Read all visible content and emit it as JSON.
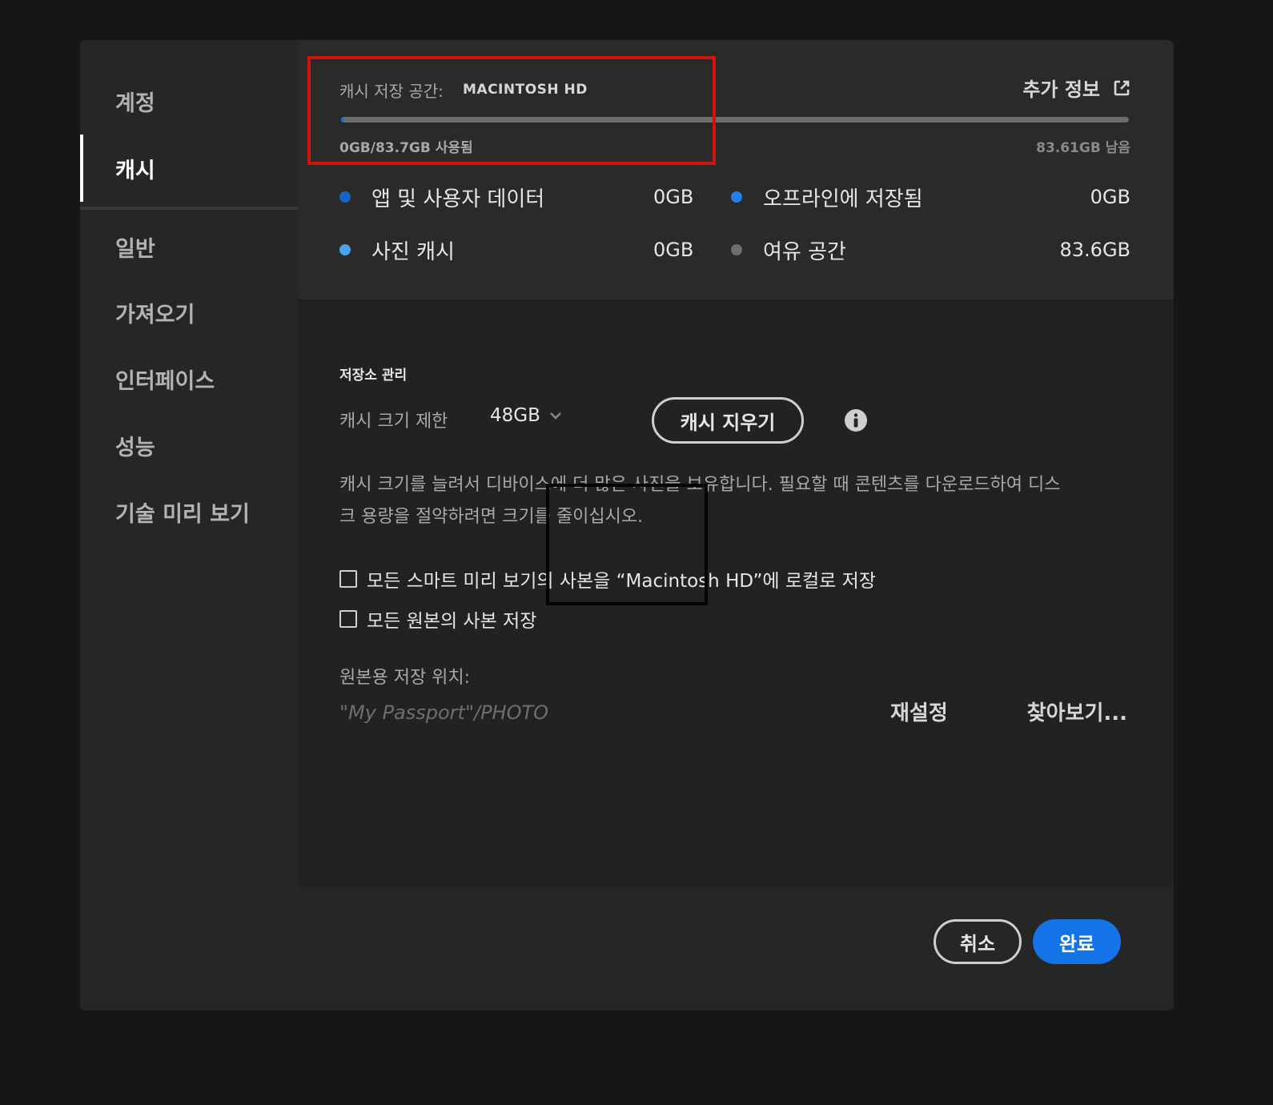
{
  "sidebar": {
    "items": [
      {
        "label": "계정",
        "active": false
      },
      {
        "label": "캐시",
        "active": true
      },
      {
        "label": "일반",
        "active": false
      },
      {
        "label": "가져오기",
        "active": false
      },
      {
        "label": "인터페이스",
        "active": false
      },
      {
        "label": "성능",
        "active": false
      },
      {
        "label": "기술 미리 보기",
        "active": false
      }
    ]
  },
  "storage": {
    "label": "캐시 저장 공간:",
    "drive_name": "MACINTOSH HD",
    "more_info": "추가 정보",
    "more_info_icon": "external-link-icon",
    "used_text": "0GB/83.7GB 사용됨",
    "remaining_text": "83.61GB 남음",
    "used_fraction": 0.001,
    "legend": [
      {
        "label": "앱 및 사용자 데이터",
        "value": "0GB",
        "color": "#1565c0"
      },
      {
        "label": "오프라인에 저장됨",
        "value": "0GB",
        "color": "#2680eb"
      },
      {
        "label": "사진 캐시",
        "value": "0GB",
        "color": "#4aa3f0"
      },
      {
        "label": "여유 공간",
        "value": "83.6GB",
        "color": "#6e6e6e"
      }
    ]
  },
  "management": {
    "title": "저장소 관리",
    "cache_limit_label": "캐시 크기 제한",
    "cache_limit_value": "48GB",
    "clear_cache": "캐시 지우기",
    "info_icon": "info-icon",
    "description": "캐시 크기를 늘려서 디바이스에 더 많은 사진을 보유합니다. 필요할 때 콘텐츠를 다운로드하여 디스크 용량을 절약하려면 크기를 줄이십시오.",
    "checkboxes": [
      {
        "label": "모든 스마트 미리 보기의 사본을 “Macintosh HD”에 로컬로 저장",
        "checked": false
      },
      {
        "label": "모든 원본의 사본 저장",
        "checked": false
      }
    ],
    "originals_location_label": "원본용 저장 위치:",
    "originals_location_path": "\"My Passport\"/PHOTO",
    "reset": "재설정",
    "browse": "찾아보기..."
  },
  "footer": {
    "cancel": "취소",
    "done": "완료"
  },
  "colors": {
    "accent": "#1473e6",
    "highlight_red": "#d0140c"
  }
}
